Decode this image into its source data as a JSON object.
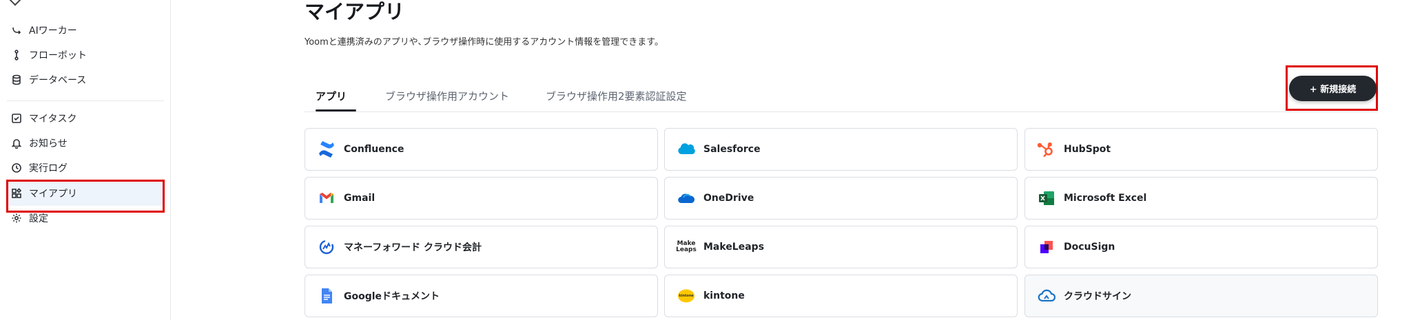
{
  "sidebar": {
    "items": [
      {
        "key": "ai-worker",
        "label": "AIワーカー",
        "icon": "ai-worker-icon"
      },
      {
        "key": "flowbot",
        "label": "フローボット",
        "icon": "flowbot-icon"
      },
      {
        "key": "database",
        "label": "データベース",
        "icon": "database-icon"
      },
      {
        "key": "my-tasks",
        "label": "マイタスク",
        "icon": "checkbox-icon"
      },
      {
        "key": "notifications",
        "label": "お知らせ",
        "icon": "bell-icon"
      },
      {
        "key": "run-log",
        "label": "実行ログ",
        "icon": "clock-icon"
      },
      {
        "key": "my-apps",
        "label": "マイアプリ",
        "icon": "apps-icon",
        "active": true
      },
      {
        "key": "settings",
        "label": "設定",
        "icon": "gear-icon"
      }
    ]
  },
  "header": {
    "title": "マイアプリ",
    "description": "Yoomと連携済みのアプリや､ブラウザ操作時に使用するアカウント情報を管理できます。"
  },
  "tabs": [
    {
      "label": "アプリ",
      "active": true
    },
    {
      "label": "ブラウザ操作用アカウント",
      "active": false
    },
    {
      "label": "ブラウザ操作用2要素認証設定",
      "active": false
    }
  ],
  "new_connection_label": "+ 新規接続",
  "apps": [
    {
      "name": "Confluence",
      "icon": "confluence-logo-icon"
    },
    {
      "name": "Salesforce",
      "icon": "salesforce-logo-icon"
    },
    {
      "name": "HubSpot",
      "icon": "hubspot-logo-icon"
    },
    {
      "name": "Gmail",
      "icon": "gmail-logo-icon"
    },
    {
      "name": "OneDrive",
      "icon": "onedrive-logo-icon"
    },
    {
      "name": "Microsoft Excel",
      "icon": "excel-logo-icon"
    },
    {
      "name": "マネーフォワード クラウド会計",
      "icon": "moneyforward-logo-icon"
    },
    {
      "name": "MakeLeaps",
      "icon": "makeleaps-logo-icon",
      "logo_text": [
        "Make",
        "Leaps"
      ]
    },
    {
      "name": "DocuSign",
      "icon": "docusign-logo-icon"
    },
    {
      "name": "Googleドキュメント",
      "icon": "google-docs-logo-icon"
    },
    {
      "name": "kintone",
      "icon": "kintone-logo-icon",
      "logo_text": "kintone"
    },
    {
      "name": "クラウドサイン",
      "icon": "cloudsign-logo-icon"
    }
  ],
  "colors": {
    "highlight": "#e00000",
    "button_bg": "#23282e",
    "active_bg": "#eef4fb"
  }
}
